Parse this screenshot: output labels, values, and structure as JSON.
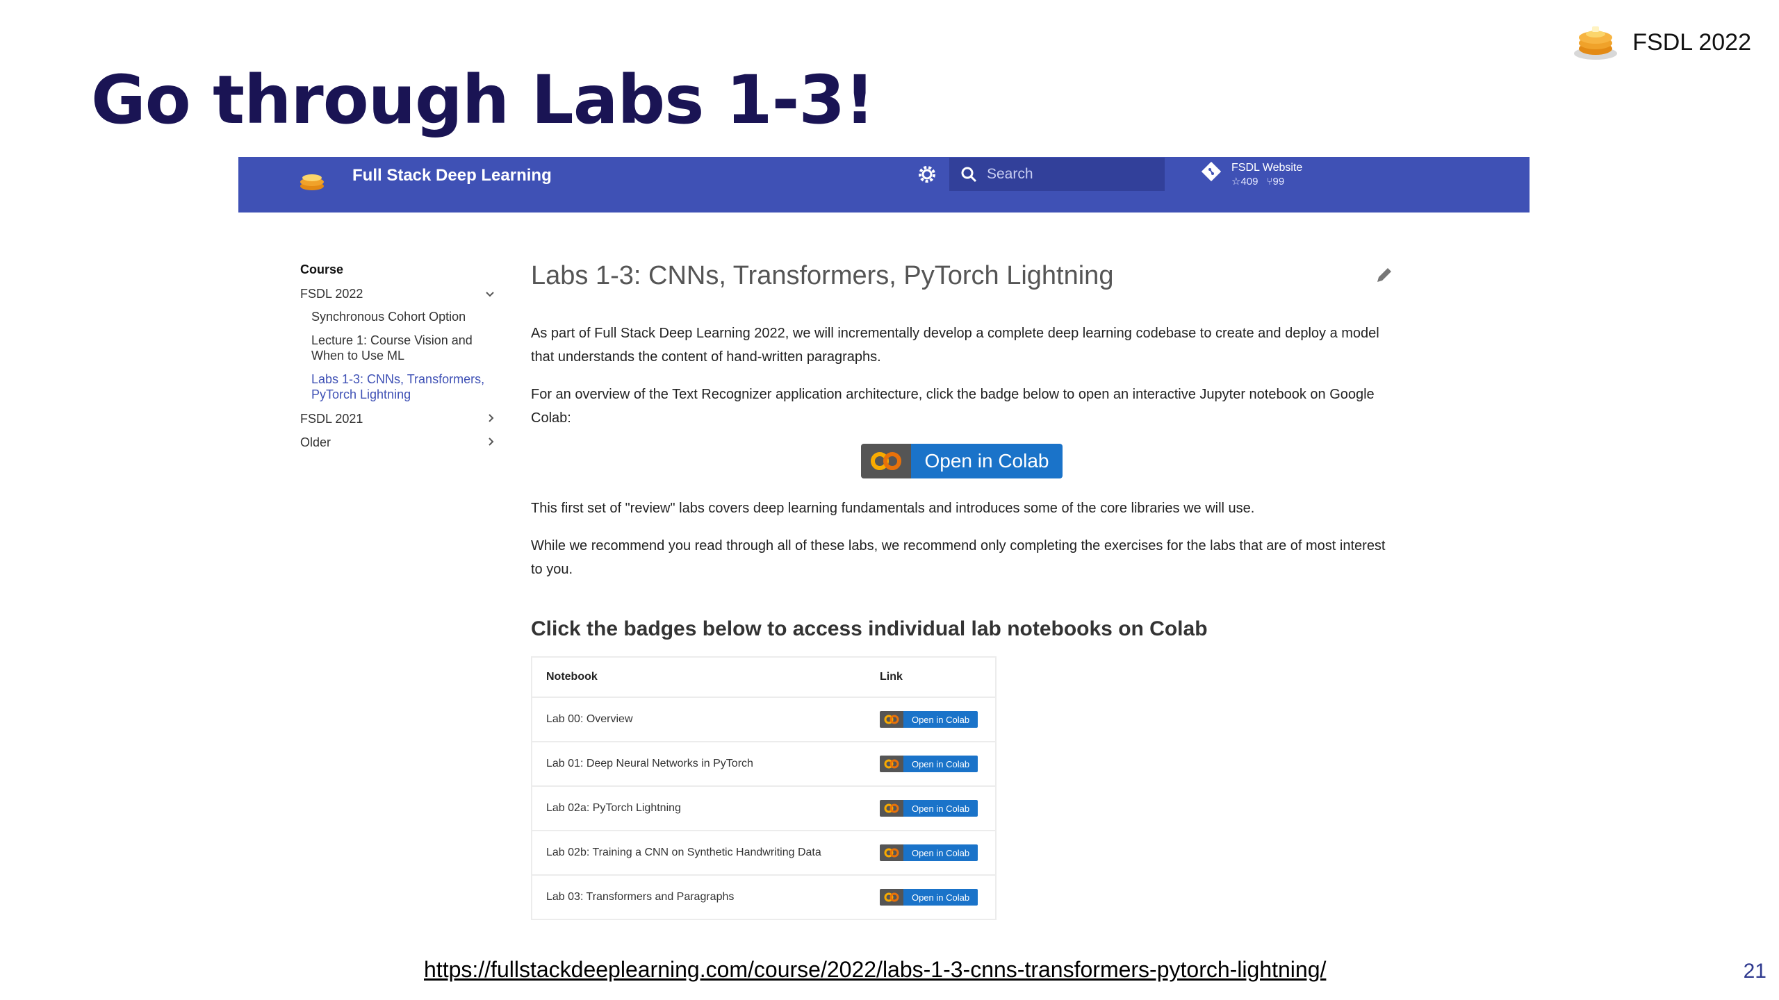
{
  "slide": {
    "title": "Go through Labs 1-3!",
    "brand": "FSDL 2022",
    "page_number": "21",
    "source_url": "https://fullstackdeeplearning.com/course/2022/labs-1-3-cnns-transformers-pytorch-lightning/"
  },
  "site": {
    "name": "Full Stack Deep Learning",
    "search_placeholder": "Search",
    "repo": {
      "title": "FSDL Website",
      "stars": "409",
      "forks": "99"
    }
  },
  "sidebar": {
    "heading": "Course",
    "sections": [
      {
        "label": "FSDL 2022",
        "chevron": "v"
      },
      {
        "label": "FSDL 2021",
        "chevron": ">"
      },
      {
        "label": "Older",
        "chevron": ">"
      }
    ],
    "sub_items": [
      {
        "label": "Synchronous Cohort Option"
      },
      {
        "label": "Lecture 1: Course Vision and When to Use ML"
      },
      {
        "label": "Labs 1-3: CNNs, Transformers, PyTorch Lightning",
        "active": true
      }
    ]
  },
  "main": {
    "heading": "Labs 1-3: CNNs, Transformers, PyTorch Lightning",
    "paragraphs": [
      "As part of Full Stack Deep Learning 2022, we will incrementally develop a complete deep learning codebase to create and deploy a model that understands the content of hand-written paragraphs.",
      "For an overview of the Text Recognizer application architecture, click the badge below to open an interactive Jupyter notebook on Google Colab:",
      "This first set of \"review\" labs covers deep learning fundamentals and introduces some of the core libraries we will use.",
      "While we recommend you read through all of these labs, we recommend only completing the exercises for the labs that are of most interest to you."
    ],
    "colab_badge_label": "Open in Colab",
    "section_heading": "Click the badges below to access individual lab notebooks on Colab",
    "table": {
      "headers": [
        "Notebook",
        "Link"
      ],
      "rows": [
        {
          "notebook": "Lab 00: Overview",
          "link": "Open in Colab"
        },
        {
          "notebook": "Lab 01: Deep Neural Networks in PyTorch",
          "link": "Open in Colab"
        },
        {
          "notebook": "Lab 02a: PyTorch Lightning",
          "link": "Open in Colab"
        },
        {
          "notebook": "Lab 02b: Training a CNN on Synthetic Handwriting Data",
          "link": "Open in Colab"
        },
        {
          "notebook": "Lab 03: Transformers and Paragraphs",
          "link": "Open in Colab"
        }
      ]
    }
  },
  "colors": {
    "header_blue": "#3f51b5",
    "title_navy": "#1a1454",
    "colab_blue": "#1a73c9",
    "colab_orange": "#f9ab00"
  },
  "icons": [
    "pancake-logo-icon",
    "gear-icon",
    "search-icon",
    "git-icon",
    "star-icon",
    "fork-icon",
    "pencil-edit-icon",
    "chevron-down-icon",
    "chevron-right-icon",
    "colab-logo-icon"
  ]
}
